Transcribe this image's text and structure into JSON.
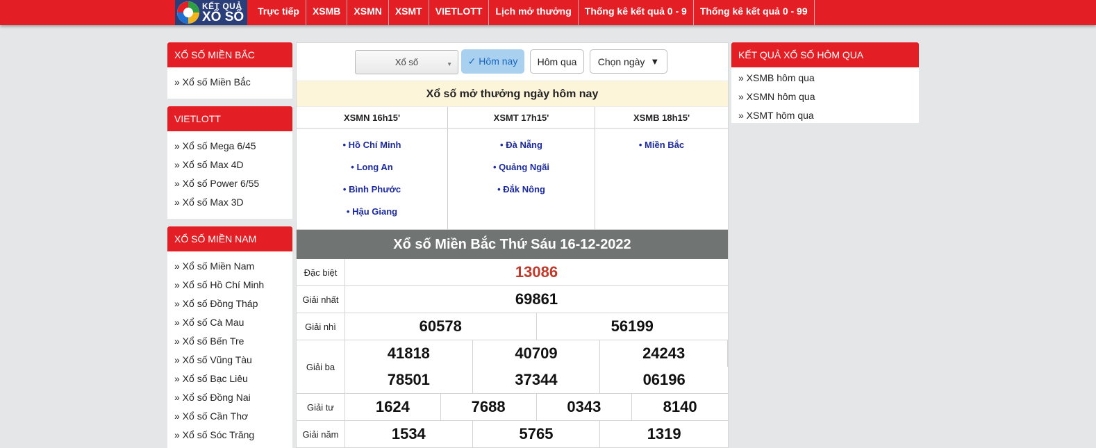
{
  "logo": {
    "line1": "KẾT QUẢ",
    "line2": "XỔ SỐ"
  },
  "nav": [
    "Trực tiếp",
    "XSMB",
    "XSMN",
    "XSMT",
    "VIETLOTT",
    "Lịch mở thưởng",
    "Thống kê kết quả 0 - 9",
    "Thống kê kết quả 0 - 99"
  ],
  "sidebar_left": {
    "mien_bac": {
      "title": "XỔ SỐ MIỀN BẮC",
      "items": [
        "» Xổ số Miền Bắc"
      ]
    },
    "vietlott": {
      "title": "VIETLOTT",
      "items": [
        "» Xổ số Mega 6/45",
        "» Xổ số Max 4D",
        "» Xổ số Power 6/55",
        "» Xổ số Max 3D"
      ]
    },
    "mien_nam": {
      "title": "XỔ SỐ MIỀN NAM",
      "items": [
        "» Xổ số Miền Nam",
        "» Xổ số Hồ Chí Minh",
        "» Xổ số Đồng Tháp",
        "» Xổ số Cà Mau",
        "» Xổ số Bến Tre",
        "» Xổ số Vũng Tàu",
        "» Xổ số Bạc Liêu",
        "» Xổ số Đồng Nai",
        "» Xổ số Cần Thơ",
        "» Xổ số Sóc Trăng"
      ]
    }
  },
  "sidebar_right": {
    "title": "KẾT QUẢ XỔ SỐ HÔM QUA",
    "items": [
      "» XSMB hôm qua",
      "» XSMN hôm qua",
      "» XSMT hôm qua"
    ]
  },
  "filter": {
    "select_value": "Xổ số",
    "today": "✓ Hôm nay",
    "yesterday": "Hôm qua",
    "pick_date": "Chọn ngày",
    "pick_arrow": "▼"
  },
  "today_title": "Xổ số mở thưởng ngày hôm nay",
  "schedule": [
    {
      "head": "XSMN 16h15'",
      "items": [
        "• Hồ Chí Minh",
        "• Long An",
        "• Bình Phước",
        "• Hậu Giang"
      ]
    },
    {
      "head": "XSMT 17h15'",
      "items": [
        "• Đà Nẵng",
        "• Quảng Ngãi",
        "• Đắk Nông"
      ]
    },
    {
      "head": "XSMB 18h15'",
      "items": [
        "• Miền Bắc"
      ]
    }
  ],
  "result": {
    "title": "Xổ số Miền Bắc Thứ Sáu 16-12-2022",
    "prizes": [
      {
        "label": "Đặc biệt",
        "values": [
          "13086"
        ]
      },
      {
        "label": "Giải nhất",
        "values": [
          "69861"
        ]
      },
      {
        "label": "Giải nhì",
        "values": [
          "60578",
          "56199"
        ]
      },
      {
        "label": "Giải ba",
        "values": [
          "41818",
          "40709",
          "24243",
          "78501",
          "37344",
          "06196"
        ]
      },
      {
        "label": "Giải tư",
        "values": [
          "1624",
          "7688",
          "0343",
          "8140"
        ]
      },
      {
        "label": "Giải năm",
        "values": [
          "1534",
          "5765",
          "1319"
        ]
      }
    ]
  },
  "colors": {
    "brand_red": "#e31e24",
    "special_prize": "#c0392b",
    "link_blue": "#1b2a9c",
    "today_bg": "#fdf5d9"
  }
}
